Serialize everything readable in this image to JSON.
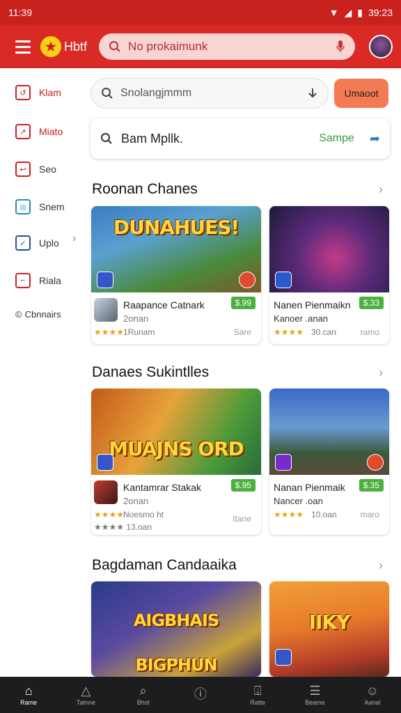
{
  "status": {
    "time": "11:39",
    "clock": "39:23"
  },
  "appbar": {
    "brand": "Hbtf",
    "search_placeholder": "No prokaimunk"
  },
  "sidebar": {
    "items": [
      {
        "label": "Klam",
        "glyph": "↺"
      },
      {
        "label": "Miato",
        "glyph": "↗"
      },
      {
        "label": "Seo",
        "glyph": "↩"
      },
      {
        "label": "Snem",
        "glyph": "◎"
      },
      {
        "label": "Uplo",
        "glyph": "✓"
      },
      {
        "label": "Riala",
        "glyph": "⌐"
      },
      {
        "label": "Cbnnairs",
        "glyph": "©"
      }
    ]
  },
  "search_bar": {
    "placeholder": "Snolangjmmm",
    "action_label": "Umaoot"
  },
  "query_bar": {
    "query": "Bam Mpllk.",
    "tag": "Sampe"
  },
  "sections": [
    {
      "title": "Roonan Chanes",
      "cards": [
        {
          "banner": "DUNAHUES!",
          "name": "Raapance Catnark",
          "sub": "2onan",
          "stars": "★★★★",
          "size": "1Runam",
          "foot": "Sare",
          "price": "$.99"
        },
        {
          "banner": "",
          "name": "Nanen Pienmaikn",
          "sub": "Kanoer .anan",
          "stars": "★★★★",
          "size": "30.can",
          "foot": "ramo",
          "price": "$.33"
        }
      ]
    },
    {
      "title": "Danaes Sukintlles",
      "cards": [
        {
          "banner": "MUAJNS ORD",
          "name": "Kantamrar Stakak",
          "sub": "2onan",
          "stars": "★★★★",
          "size": "Noesmo ht",
          "foot": "Itane",
          "price": "$.95",
          "size2": "★★★★ 13.oan"
        },
        {
          "banner": "",
          "name": "Nanan Pienmaik",
          "sub": "Nancer .oan",
          "stars": "★★★★",
          "size": "10.oan",
          "foot": "maro",
          "price": "$.35"
        }
      ]
    },
    {
      "title": "Bagdaman Candaaika",
      "cards": [
        {
          "banner": "AIGBHAIS BIGPHUN",
          "name": "",
          "sub": "",
          "stars": "",
          "size": "",
          "foot": "",
          "price": ""
        },
        {
          "banner": "IIKY",
          "name": "",
          "sub": "",
          "stars": "",
          "size": "",
          "foot": "",
          "price": ""
        }
      ]
    }
  ],
  "bottom_nav": [
    {
      "label": "Rame",
      "glyph": "⌂"
    },
    {
      "label": "Tatnne",
      "glyph": "△"
    },
    {
      "label": "Bhst",
      "glyph": "⌕"
    },
    {
      "label": "",
      "glyph": "ⓘ"
    },
    {
      "label": "Ratte",
      "glyph": "⍗"
    },
    {
      "label": "Beame",
      "glyph": "☰"
    },
    {
      "label": "Aanal",
      "glyph": "☺"
    }
  ]
}
